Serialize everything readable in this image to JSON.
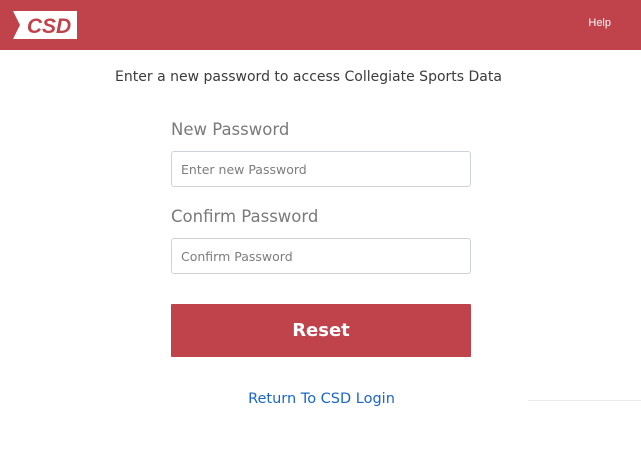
{
  "header": {
    "logo_text": "CSD",
    "help_label": "Help"
  },
  "form": {
    "intro": "Enter a new password to access Collegiate Sports Data",
    "new_password_label": "New Password",
    "new_password_placeholder": "Enter new Password",
    "new_password_value": "",
    "confirm_password_label": "Confirm Password",
    "confirm_password_placeholder": "Confirm Password",
    "confirm_password_value": "",
    "reset_label": "Reset",
    "return_link": "Return To CSD Login"
  },
  "colors": {
    "brand": "#c0424a",
    "link": "#1a66c9",
    "label": "#7a7a7a"
  }
}
